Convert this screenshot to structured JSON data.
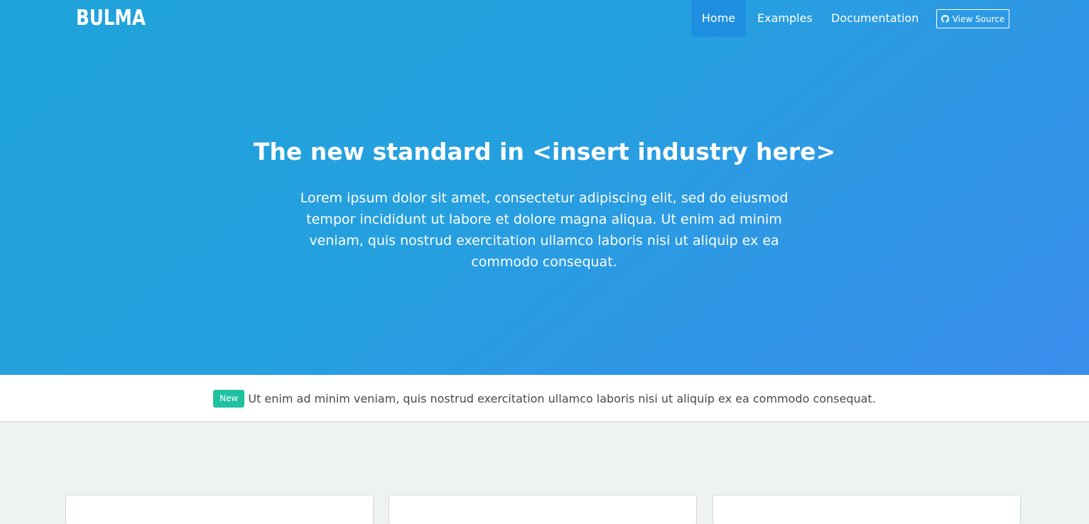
{
  "navbar": {
    "logo_text": "BULMA",
    "items": [
      {
        "label": "Home",
        "active": true
      },
      {
        "label": "Examples",
        "active": false
      },
      {
        "label": "Documentation",
        "active": false
      }
    ],
    "view_source": {
      "label": "View Source",
      "icon": "github-icon"
    }
  },
  "hero": {
    "title": "The new standard in <insert industry here>",
    "subtitle": "Lorem ipsum dolor sit amet, consectetur adipiscing elit, sed do eiusmod tempor incididunt ut labore et dolore magna aliqua. Ut enim ad minim veniam, quis nostrud exercitation ullamco laboris nisi ut aliquip ex ea commodo consequat."
  },
  "announcement": {
    "tag": "New",
    "text": "Ut enim ad minim veniam, quis nostrud exercitation ullamco laboris nisi ut aliquip ex ea commodo consequat."
  },
  "colors": {
    "hero_gradient_start": "#1fa3d9",
    "hero_gradient_end": "#3a8ded",
    "nav_active_bg": "#1e8fe0",
    "tag_new": "#1fc1a0",
    "page_bg": "#eff2f3",
    "text_dark": "#4a4a4a"
  }
}
